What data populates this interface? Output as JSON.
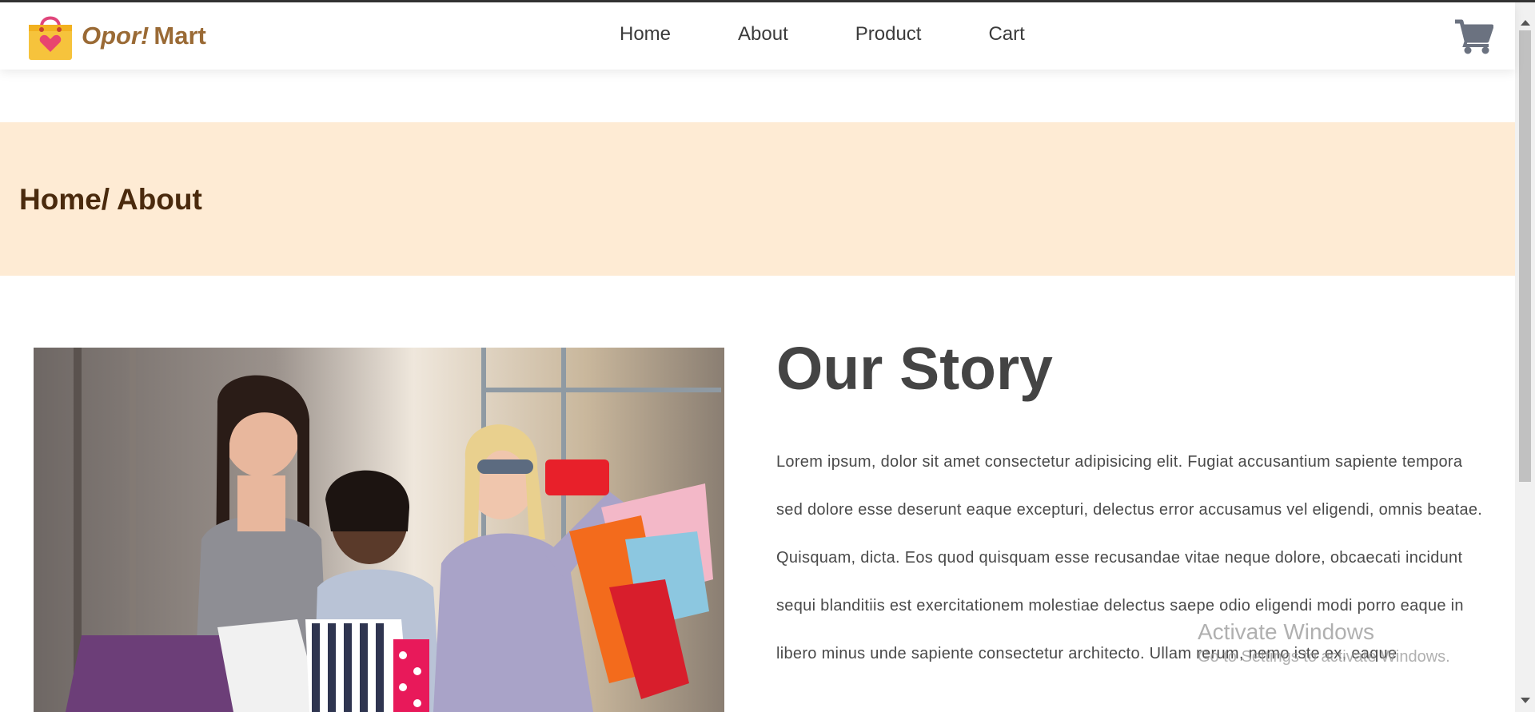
{
  "header": {
    "brand_part1": "Opor!",
    "brand_part2": "Mart",
    "nav": [
      {
        "label": "Home"
      },
      {
        "label": "About"
      },
      {
        "label": "Product"
      },
      {
        "label": "Cart"
      }
    ],
    "cart_icon": "cart-icon",
    "logo_icon": "shopping-bag-heart-icon"
  },
  "banner": {
    "breadcrumb": "Home/ About"
  },
  "story": {
    "title": "Our Story",
    "text": "Lorem ipsum, dolor sit amet consectetur adipisicing elit. Fugiat accusantium sapiente tempora sed dolore esse deserunt eaque excepturi, delectus error accusamus vel eligendi, omnis beatae. Quisquam, dicta. Eos quod quisquam esse recusandae vitae neque dolore, obcaecati incidunt sequi blanditiis est exercitationem molestiae delectus saepe odio eligendi modi porro eaque in libero minus unde sapiente consectetur architecto. Ullam rerum, nemo iste ex, eaque",
    "image": "women-shopping-selfie-photo"
  },
  "watermark": {
    "title": "Activate Windows",
    "subtitle": "Go to Settings to activate Windows."
  },
  "colors": {
    "brand": "#9a6a35",
    "banner_bg": "#feebd4",
    "breadcrumb": "#4a2a0d",
    "nav_text": "#3b3b3b",
    "cart_icon": "#6b7280"
  }
}
